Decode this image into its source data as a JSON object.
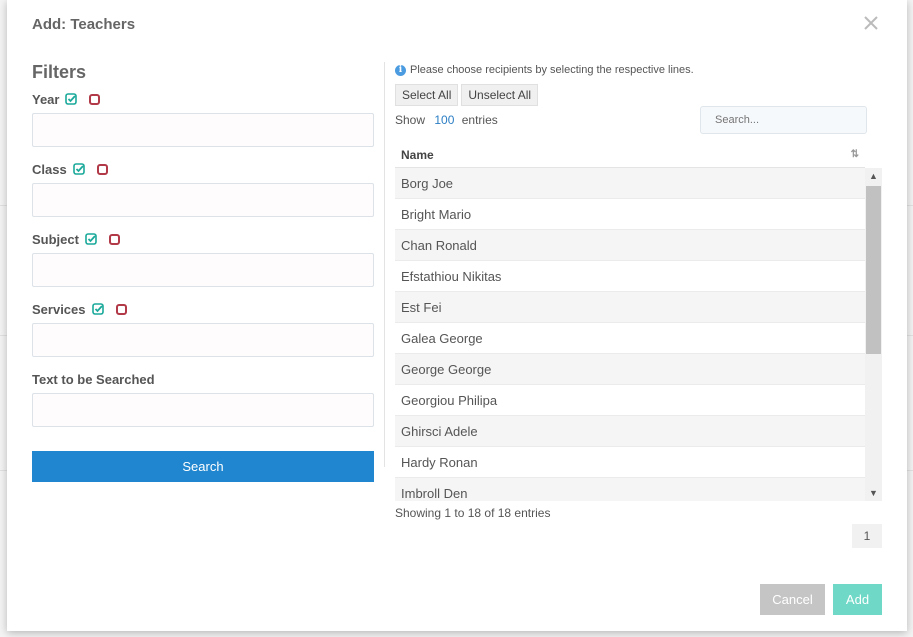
{
  "modal": {
    "title": "Add: Teachers"
  },
  "filters": {
    "title": "Filters",
    "fields": [
      {
        "label": "Year"
      },
      {
        "label": "Class"
      },
      {
        "label": "Subject"
      },
      {
        "label": "Services"
      }
    ],
    "text_search_label": "Text to be Searched",
    "search_button": "Search"
  },
  "recipients": {
    "info": "Please choose recipients by selecting the respective lines.",
    "select_all": "Select All",
    "unselect_all": "Unselect All",
    "show_label": "Show",
    "entries_count": "100",
    "entries_label": "entries",
    "search_placeholder": "Search...",
    "column_header": "Name",
    "rows": [
      "Borg Joe",
      "Bright Mario",
      "Chan Ronald",
      "Efstathiou Nikitas",
      "Est Fei",
      "Galea George",
      "George George",
      "Georgiou Philipa",
      "Ghirsci Adele",
      "Hardy Ronan",
      "Imbroll Den"
    ],
    "footer": "Showing 1 to 18 of 18 entries",
    "page": "1"
  },
  "actions": {
    "cancel": "Cancel",
    "add": "Add"
  },
  "colors": {
    "primary": "#1f86cf",
    "add": "#6fd8c7",
    "check": "#1aa99a",
    "uncheck": "#b23a48"
  },
  "icons": [
    "close-icon",
    "check-icon",
    "uncheck-icon",
    "info-icon",
    "sort-icon",
    "chevron-up-icon",
    "chevron-down-icon"
  ]
}
